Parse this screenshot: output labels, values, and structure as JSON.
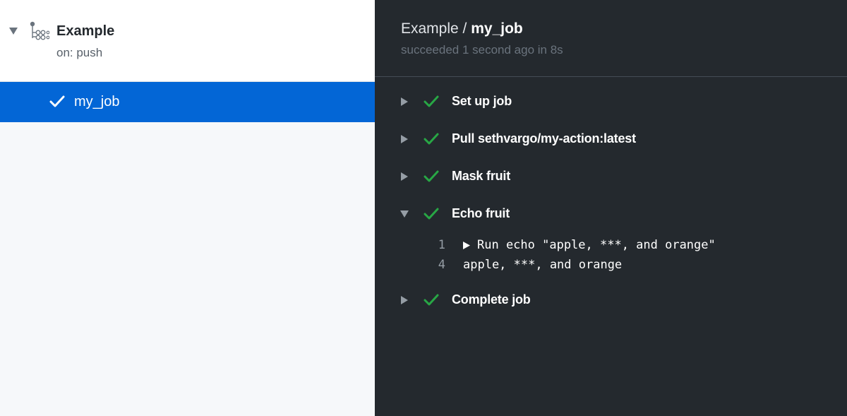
{
  "workflow": {
    "name": "Example",
    "trigger": "on: push",
    "jobs": [
      {
        "label": "my_job",
        "status": "success",
        "selected": true
      }
    ]
  },
  "job": {
    "workflow_name": "Example",
    "separator": " / ",
    "job_name": "my_job",
    "status_text": "succeeded 1 second ago in 8s"
  },
  "steps": [
    {
      "label": "Set up job",
      "expanded": false,
      "status": "success"
    },
    {
      "label": "Pull sethvargo/my-action:latest",
      "expanded": false,
      "status": "success"
    },
    {
      "label": "Mask fruit",
      "expanded": false,
      "status": "success"
    },
    {
      "label": "Echo fruit",
      "expanded": true,
      "status": "success"
    },
    {
      "label": "Complete job",
      "expanded": false,
      "status": "success"
    }
  ],
  "log_lines": [
    {
      "number": "1",
      "text": "Run echo \"apple, ***, and orange\"",
      "collapsible": true
    },
    {
      "number": "4",
      "text": "apple, ***, and orange",
      "collapsible": false
    }
  ],
  "colors": {
    "success": "#28a745",
    "selected": "#0366d6",
    "dark_bg": "#24292e"
  }
}
